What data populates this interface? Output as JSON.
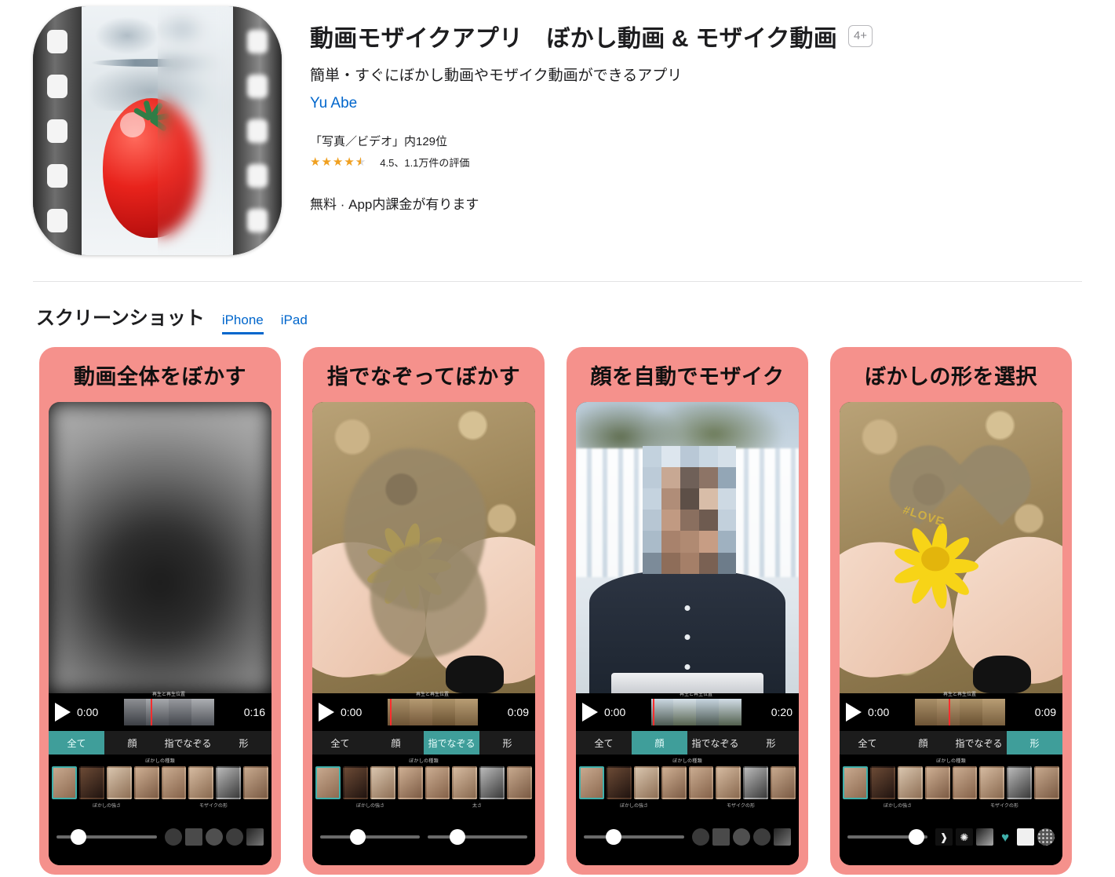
{
  "app": {
    "title": "動画モザイクアプリ　ぼかし動画 & モザイク動画",
    "age_rating": "4+",
    "subtitle": "簡単・すぐにぼかし動画やモザイク動画ができるアプリ",
    "developer": "Yu Abe",
    "rank": "「写真／ビデオ」内129位",
    "rating_value": 4.5,
    "rating_text": "4.5、1.1万件の評価",
    "price": "無料 · App内課金が有ります",
    "icon_name": "video-mosaic-app-icon"
  },
  "screenshots_section": {
    "heading": "スクリーンショット",
    "tabs": [
      {
        "label": "iPhone",
        "active": true
      },
      {
        "label": "iPad",
        "active": false
      }
    ],
    "accent_color": "#0066cc",
    "card_color": "#f5918c",
    "active_mode_color": "#3f9e9a"
  },
  "shots": [
    {
      "caption": "動画全体をぼかす",
      "time_start": "0:00",
      "time_end": "0:16",
      "scrubber_label": "再生と再生位置",
      "modes": [
        "全て",
        "顔",
        "指でなぞる",
        "形"
      ],
      "active_mode": "全て",
      "fx_label": "ぼかしの種類",
      "control_labels": [
        "ぼかしの強さ",
        "モザイクの形"
      ],
      "slider_value": 22
    },
    {
      "caption": "指でなぞってぼかす",
      "time_start": "0:00",
      "time_end": "0:09",
      "scrubber_label": "再生と再生位置",
      "modes": [
        "全て",
        "顔",
        "指でなぞる",
        "形"
      ],
      "active_mode": "指でなぞる",
      "fx_label": "ぼかしの種類",
      "control_labels": [
        "ぼかしの強さ",
        "太さ"
      ],
      "slider_value": 38,
      "slider_value_2": 30
    },
    {
      "caption": "顔を自動でモザイク",
      "time_start": "0:00",
      "time_end": "0:20",
      "scrubber_label": "再生と再生位置",
      "modes": [
        "全て",
        "顔",
        "指でなぞる",
        "形"
      ],
      "active_mode": "顔",
      "fx_label": "ぼかしの種類",
      "control_labels": [
        "ぼかしの強さ",
        "モザイクの形"
      ],
      "slider_value": 30
    },
    {
      "caption": "ぼかしの形を選択",
      "time_start": "0:00",
      "time_end": "0:09",
      "scrubber_label": "再生と再生位置",
      "modes": [
        "全て",
        "顔",
        "指でなぞる",
        "形"
      ],
      "active_mode": "形",
      "fx_label": "ぼかしの種類",
      "control_labels": [
        "ぼかしの強さ",
        "モザイクの形"
      ],
      "slider_value": 86,
      "shape_icons": [
        "brush-shape-icon",
        "splat-shape-icon",
        "swirl-shape-icon",
        "heart-shape-icon",
        "square-shape-icon",
        "dots-shape-icon"
      ]
    }
  ],
  "overlay_text": {
    "love": "#LOVE"
  }
}
